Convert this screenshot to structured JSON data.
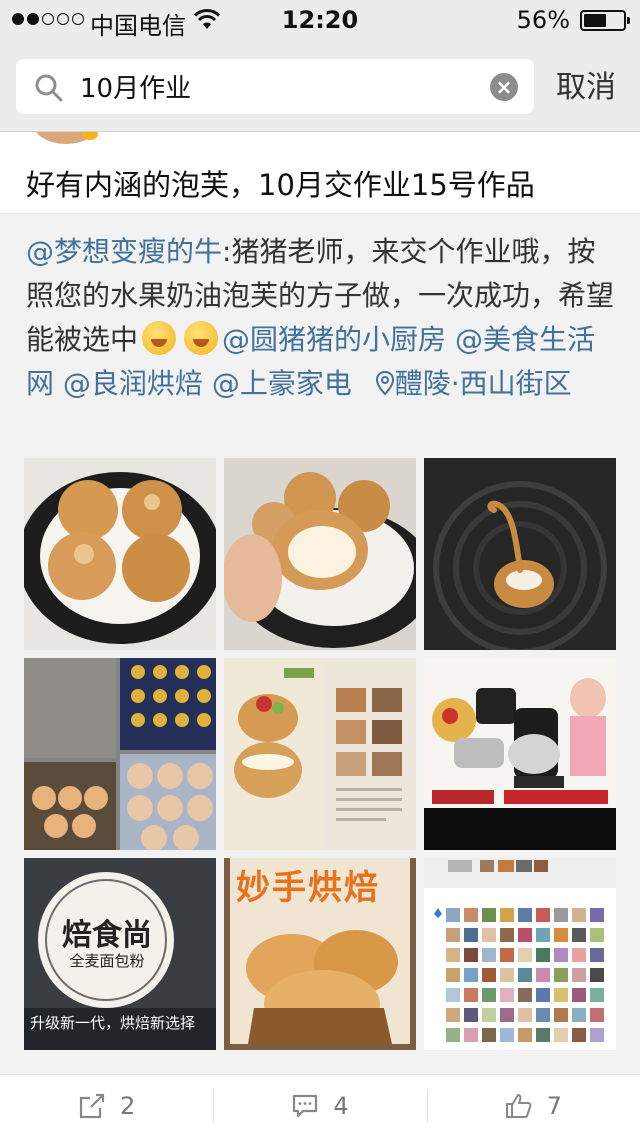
{
  "status_bar": {
    "carrier": "中国电信",
    "time": "12:20",
    "battery": "56%",
    "battery_level": 0.56,
    "signal_bars": 2
  },
  "search": {
    "query": "10月作业",
    "cancel_label": "取消"
  },
  "post": {
    "title": "好有内涵的泡芙，10月交作业15号作品",
    "author_mention": "@梦想变瘦的牛",
    "body": ":猪猪老师，来交个作业哦，按照您的水果奶油泡芙的方子做，一次成功，希望能被选中",
    "mentions": [
      "@圆猪猪的小厨房",
      "@美食生活网",
      "@良润烘焙",
      "@上豪家电"
    ],
    "location": "醴陵·西山街区",
    "images": [
      {
        "icon": "puff-plate-photo"
      },
      {
        "icon": "puff-cream-photo"
      },
      {
        "icon": "swan-puff-photo"
      },
      {
        "icon": "dough-collage-photo"
      },
      {
        "icon": "recipe-book-photo"
      },
      {
        "icon": "mixer-ad-photo"
      },
      {
        "icon": "flour-brand-photo",
        "brand": "焙食尚",
        "sub": "全麦面包粉",
        "slogan": "升级新一代，烘焙新选择"
      },
      {
        "icon": "magazine-photo",
        "mag_title": "妙手烘焙"
      },
      {
        "icon": "avatar-grid-screenshot"
      }
    ]
  },
  "actions": {
    "repost_count": "2",
    "comment_count": "4",
    "like_count": "7"
  },
  "colors": {
    "link": "#40729c",
    "bar_bg": "#ececec",
    "body_bg": "#f2f2f2"
  }
}
